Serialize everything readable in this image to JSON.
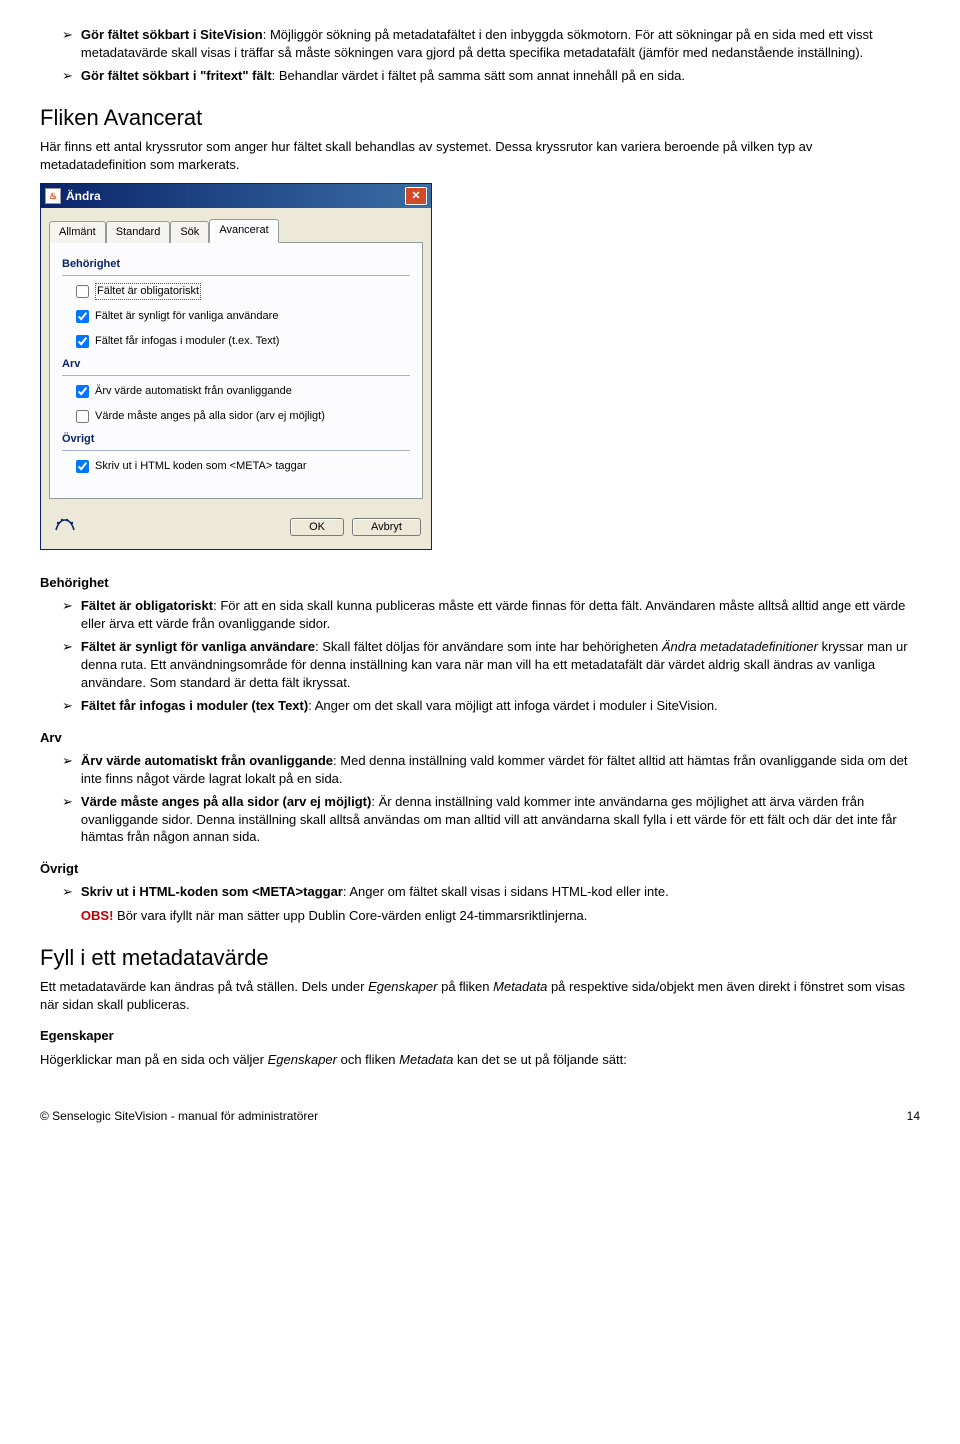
{
  "bullets_top": [
    {
      "lead": "Gör fältet sökbart i SiteVision",
      "rest": ": Möjliggör sökning på metadatafältet i den inbyggda sökmotorn. För att sökningar på en sida med ett visst metadatavärde skall visas i träffar så måste sökningen vara gjord på detta specifika metadatafält (jämför med nedanstående inställning)."
    },
    {
      "lead": "Gör fältet sökbart i \"fritext\" fält",
      "rest": ": Behandlar värdet i fältet på samma sätt som annat innehåll på en sida."
    }
  ],
  "section_avancerat": {
    "heading": "Fliken Avancerat",
    "intro": "Här finns ett antal kryssrutor som anger hur fältet skall behandlas av systemet. Dessa kryssrutor kan variera beroende på vilken typ av metadatadefinition som markerats."
  },
  "dialog": {
    "title": "Ändra",
    "tabs": [
      "Allmänt",
      "Standard",
      "Sök",
      "Avancerat"
    ],
    "active_tab": 3,
    "groups": {
      "behorighet": {
        "title": "Behörighet",
        "rows": [
          {
            "label": "Fältet är obligatoriskt",
            "checked": false,
            "focused": true
          },
          {
            "label": "Fältet är synligt för vanliga användare",
            "checked": true
          },
          {
            "label": "Fältet får infogas i moduler (t.ex. Text)",
            "checked": true
          }
        ]
      },
      "arv": {
        "title": "Arv",
        "rows": [
          {
            "label": "Ärv värde automatiskt från ovanliggande",
            "checked": true
          },
          {
            "label": "Värde måste anges på alla sidor (arv ej möjligt)",
            "checked": false
          }
        ]
      },
      "ovrigt": {
        "title": "Övrigt",
        "rows": [
          {
            "label": "Skriv ut i HTML koden som <META> taggar",
            "checked": true
          }
        ]
      }
    },
    "buttons": {
      "ok": "OK",
      "cancel": "Avbryt"
    }
  },
  "subsections": {
    "behorighet": {
      "title": "Behörighet",
      "bullets": [
        {
          "lead": "Fältet är obligatoriskt",
          "rest": ": För att en sida skall kunna publiceras måste ett värde finnas för detta fält. Användaren måste alltså alltid ange ett värde eller ärva ett värde från ovanliggande sidor."
        },
        {
          "lead": "Fältet är synligt för vanliga användare",
          "rest": ": Skall fältet döljas för användare som inte har behörigheten ",
          "italic": "Ändra metadatadefinitioner",
          "after": " kryssar man ur denna ruta. Ett användningsområde för denna inställning kan vara när man vill ha ett metadatafält där värdet aldrig skall ändras av vanliga användare. Som standard är detta fält ikryssat."
        },
        {
          "lead": "Fältet får infogas i moduler (tex Text)",
          "rest": ": Anger om det skall vara möjligt att infoga värdet i moduler i SiteVision."
        }
      ]
    },
    "arv": {
      "title": "Arv",
      "bullets": [
        {
          "lead": "Ärv värde automatiskt från ovanliggande",
          "rest": ": Med denna inställning vald kommer värdet för fältet alltid att hämtas från ovanliggande sida om det inte finns något värde lagrat lokalt på en sida."
        },
        {
          "lead": "Värde måste anges på alla sidor (arv ej möjligt)",
          "rest": ": Är denna inställning vald kommer inte användarna ges möjlighet att ärva värden från ovanliggande sidor. Denna inställning skall alltså användas om man alltid vill att användarna skall fylla i ett värde för ett fält och där det inte får hämtas från någon annan sida."
        }
      ]
    },
    "ovrigt": {
      "title": "Övrigt",
      "bullets": [
        {
          "lead": "Skriv ut i HTML-koden som <META>taggar",
          "rest": ": Anger om fältet skall visas i sidans HTML-kod eller inte."
        }
      ],
      "obs_label": "OBS!",
      "obs_text": " Bör vara ifyllt när man sätter upp Dublin Core-värden enligt 24-timmarsriktlinjerna."
    }
  },
  "section_fyll": {
    "heading": "Fyll i ett metadatavärde",
    "para": {
      "pre": "Ett metadatavärde kan ändras på två ställen. Dels under ",
      "i1": "Egenskaper",
      "mid1": " på fliken ",
      "i2": "Metadata",
      "mid2": " på respektive sida/objekt men även direkt i fönstret som visas när sidan skall publiceras."
    },
    "egenskaper_head": "Egenskaper",
    "egenskaper_para": {
      "pre": "Högerklickar man på en sida och väljer ",
      "i1": "Egenskaper",
      "mid1": " och fliken ",
      "i2": "Metadata",
      "mid2": " kan det se ut på följande sätt:"
    }
  },
  "footer": {
    "left": "© Senselogic SiteVision - manual för administratörer",
    "right": "14"
  }
}
